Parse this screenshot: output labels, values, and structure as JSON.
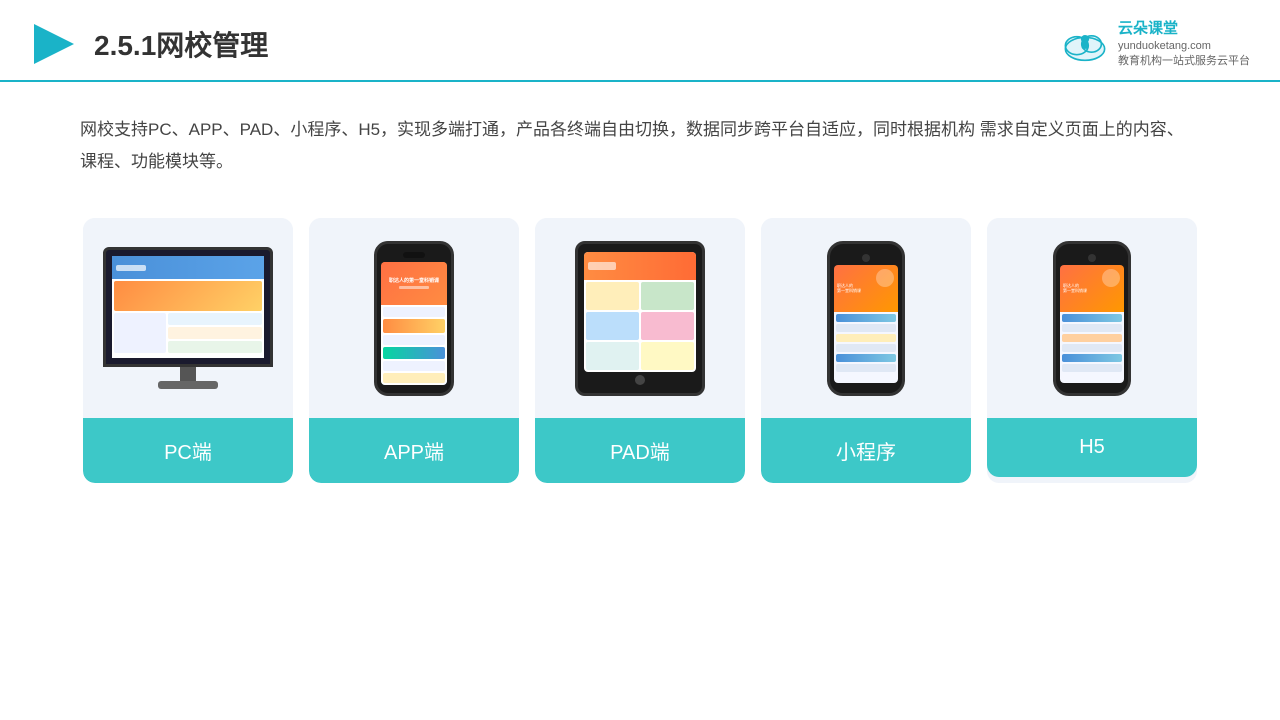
{
  "header": {
    "title": "2.5.1网校管理",
    "brand_name": "云朵课堂",
    "brand_site": "yunduoketang.com",
    "brand_subtitle": "教育机构一站\n式服务云平台"
  },
  "description": "网校支持PC、APP、PAD、小程序、H5，实现多端打通，产品各终端自由切换，数据同步跨平台自适应，同时根据机构\n需求自定义页面上的内容、课程、功能模块等。",
  "cards": [
    {
      "id": "pc",
      "label": "PC端"
    },
    {
      "id": "app",
      "label": "APP端"
    },
    {
      "id": "pad",
      "label": "PAD端"
    },
    {
      "id": "mini",
      "label": "小程序"
    },
    {
      "id": "h5",
      "label": "H5"
    }
  ],
  "colors": {
    "teal": "#3dc8c8",
    "accent": "#1ab3c8",
    "text_dark": "#333",
    "text_mid": "#444",
    "bg_card": "#f0f4fa"
  }
}
